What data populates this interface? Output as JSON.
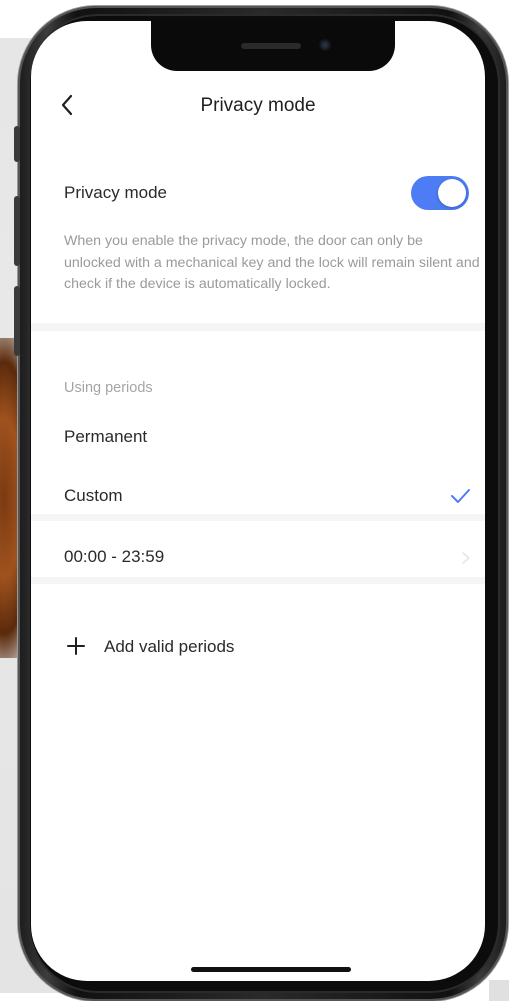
{
  "navbar": {
    "title": "Privacy mode"
  },
  "privacy": {
    "label": "Privacy mode",
    "enabled": true,
    "description": "When you enable the privacy mode, the door can only be unlocked with a mechanical key and the lock will remain silent and check if the device is automatically locked."
  },
  "periods": {
    "section_label": "Using periods",
    "options": [
      {
        "label": "Permanent",
        "selected": false
      },
      {
        "label": "Custom",
        "selected": true
      }
    ],
    "time_range": "00:00 - 23:59",
    "add_label": "Add valid periods"
  },
  "colors": {
    "accent": "#4d7cf5",
    "text_primary": "#2a2a2a",
    "text_secondary": "#9a9a9a",
    "divider": "#f5f5f5"
  },
  "icons": [
    "chevron-left-icon",
    "check-icon",
    "chevron-right-icon",
    "plus-icon"
  ]
}
